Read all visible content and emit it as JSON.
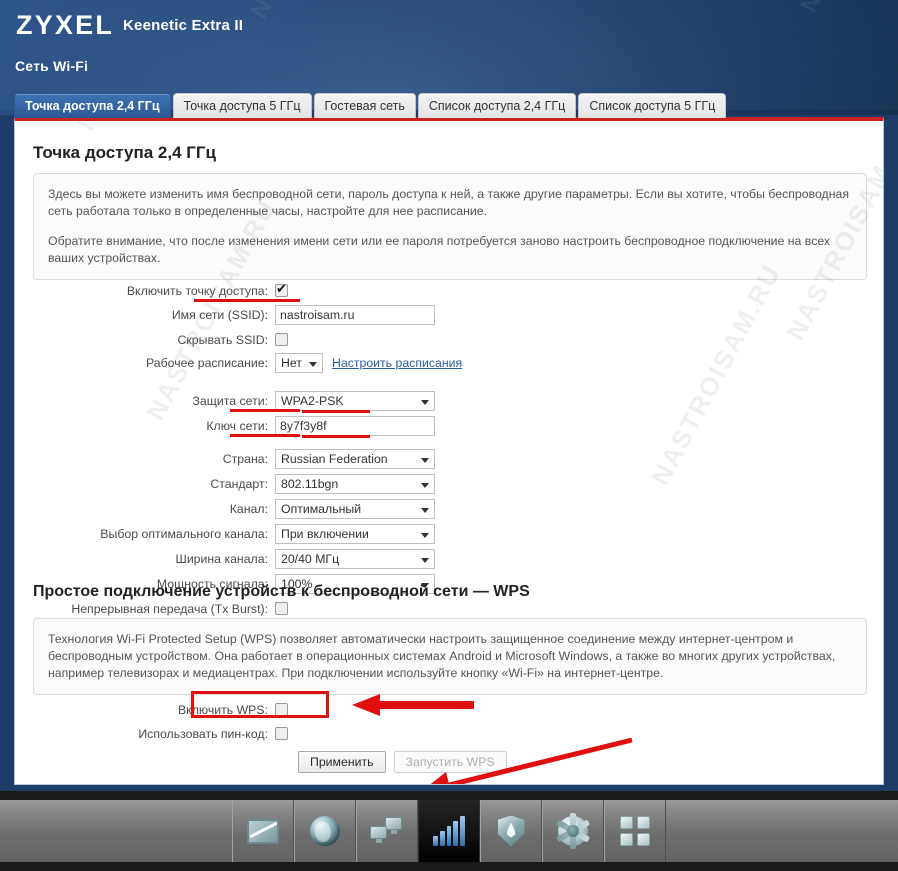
{
  "header": {
    "logo": "ZYXEL",
    "model": "Keenetic Extra II",
    "section_title": "Сеть Wi-Fi",
    "watermark": "NASTROISAM.RU"
  },
  "tabs": [
    {
      "label": "Точка доступа 2,4 ГГц",
      "active": true
    },
    {
      "label": "Точка доступа 5 ГГц",
      "active": false
    },
    {
      "label": "Гостевая сеть",
      "active": false
    },
    {
      "label": "Список доступа 2,4 ГГц",
      "active": false
    },
    {
      "label": "Список доступа 5 ГГц",
      "active": false
    }
  ],
  "page": {
    "heading": "Точка доступа 2,4 ГГц",
    "info_paragraph_1": "Здесь вы можете изменить имя беспроводной сети, пароль доступа к ней, а также другие параметры. Если вы хотите, чтобы беспроводная сеть работала только в определенные часы, настройте для нее расписание.",
    "info_paragraph_2": "Обратите внимание, что после изменения имени сети или ее пароля потребуется заново настроить беспроводное подключение на всех ваших устройствах."
  },
  "form": {
    "enable_ap_label": "Включить точку доступа:",
    "enable_ap_checked": true,
    "ssid_label": "Имя сети (SSID):",
    "ssid_value": "nastroisam.ru",
    "hide_ssid_label": "Скрывать SSID:",
    "hide_ssid_checked": false,
    "schedule_label": "Рабочее расписание:",
    "schedule_value": "Нет",
    "schedule_link": "Настроить расписания",
    "security_label": "Защита сети:",
    "security_value": "WPA2-PSK",
    "key_label": "Ключ сети:",
    "key_value": "8y7f3y8f",
    "country_label": "Страна:",
    "country_value": "Russian Federation",
    "standard_label": "Стандарт:",
    "standard_value": "802.11bgn",
    "channel_label": "Канал:",
    "channel_value": "Оптимальный",
    "autochannel_label": "Выбор оптимального канала:",
    "autochannel_value": "При включении",
    "bandwidth_label": "Ширина канала:",
    "bandwidth_value": "20/40 МГц",
    "power_label": "Мощность сигнала:",
    "power_value": "100%",
    "txburst_label": "Непрерывная передача (Tx Burst):",
    "txburst_checked": false
  },
  "wps": {
    "heading": "Простое подключение устройств к беспроводной сети — WPS",
    "info": "Технология Wi-Fi Protected Setup (WPS) позволяет автоматически настроить защищенное соединение между интернет-центром и беспроводным устройством. Она работает в операционных системах Android и Microsoft Windows, а также во многих других устройствах, например телевизорах и медиацентрах. При подключении используйте кнопку «Wi-Fi» на интернет-центре.",
    "enable_label": "Включить WPS:",
    "enable_checked": false,
    "pin_label": "Использовать пин-код:",
    "pin_checked": false,
    "apply_button": "Применить",
    "start_button": "Запустить WPS"
  },
  "taskbar": {
    "items": [
      {
        "icon": "system-monitor-icon",
        "active": false
      },
      {
        "icon": "internet-globe-icon",
        "active": false
      },
      {
        "icon": "home-network-icon",
        "active": false
      },
      {
        "icon": "wifi-signal-icon",
        "active": true
      },
      {
        "icon": "firewall-shield-icon",
        "active": false
      },
      {
        "icon": "settings-gear-icon",
        "active": false
      },
      {
        "icon": "apps-grid-icon",
        "active": false
      }
    ]
  },
  "annotation": {
    "accent_color": "#dd1111",
    "highlight_color": "#e01010"
  }
}
